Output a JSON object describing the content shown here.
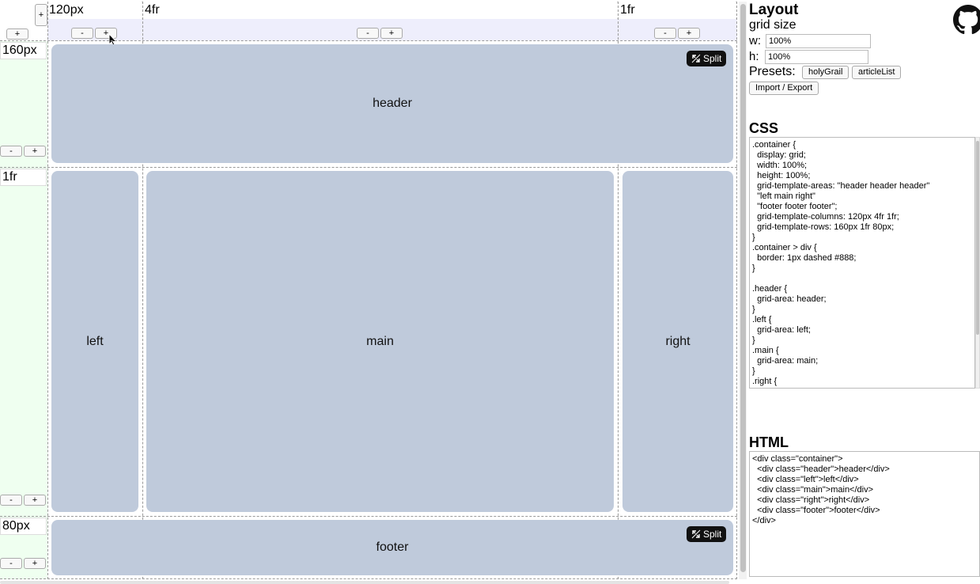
{
  "columns": [
    {
      "size": "120px"
    },
    {
      "size": "4fr"
    },
    {
      "size": "1fr"
    }
  ],
  "rows": [
    {
      "size": "160px"
    },
    {
      "size": "1fr"
    },
    {
      "size": "80px"
    }
  ],
  "controls": {
    "minus": "-",
    "plus": "+"
  },
  "areas": {
    "header": "header",
    "left": "left",
    "main": "main",
    "right": "right",
    "footer": "footer",
    "split_label": "Split"
  },
  "panel": {
    "title": "Layout",
    "grid_size_label": "grid size",
    "w_label": "w:",
    "w_value": "100%",
    "h_label": "h:",
    "h_value": "100%",
    "presets_label": "Presets:",
    "presets": [
      "holyGrail",
      "articleList"
    ],
    "import_export": "Import / Export",
    "css_heading": "CSS",
    "css_code": ".container {\n  display: grid;\n  width: 100%;\n  height: 100%;\n  grid-template-areas: \"header header header\"\n  \"left main right\"\n  \"footer footer footer\";\n  grid-template-columns: 120px 4fr 1fr;\n  grid-template-rows: 160px 1fr 80px;\n}\n.container > div {\n  border: 1px dashed #888;\n}\n\n.header {\n  grid-area: header;\n}\n.left {\n  grid-area: left;\n}\n.main {\n  grid-area: main;\n}\n.right {",
    "html_heading": "HTML",
    "html_code": "<div class=\"container\">\n  <div class=\"header\">header</div>\n  <div class=\"left\">left</div>\n  <div class=\"main\">main</div>\n  <div class=\"right\">right</div>\n  <div class=\"footer\">footer</div>\n</div>"
  },
  "colors": {
    "cell": "#bfcadb",
    "column_strip": "#eeeefc",
    "row_strip": "#effff0",
    "split_bg": "#111111"
  },
  "icons": [
    "github-icon",
    "split-icon",
    "mouse-cursor-icon"
  ]
}
